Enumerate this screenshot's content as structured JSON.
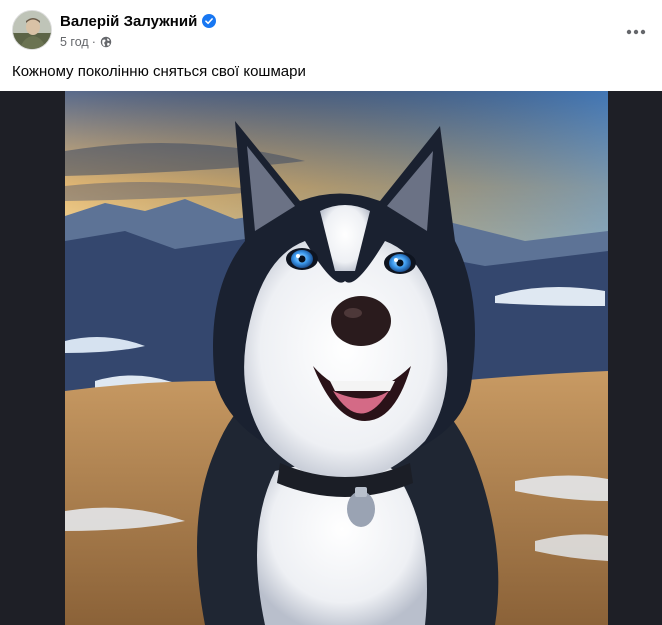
{
  "post": {
    "author": "Валерій Залужний",
    "verified": true,
    "time": "5 год",
    "separator": "·",
    "privacy_icon": "globe-icon",
    "more_icon": "more-horizontal-icon",
    "text": "Кожному поколінню сняться свої кошмари"
  },
  "media": {
    "description_icon": "husky-photo",
    "frame_color": "#1e1f26"
  },
  "colors": {
    "verified": "#1877f2",
    "meta_text": "#65676b"
  }
}
